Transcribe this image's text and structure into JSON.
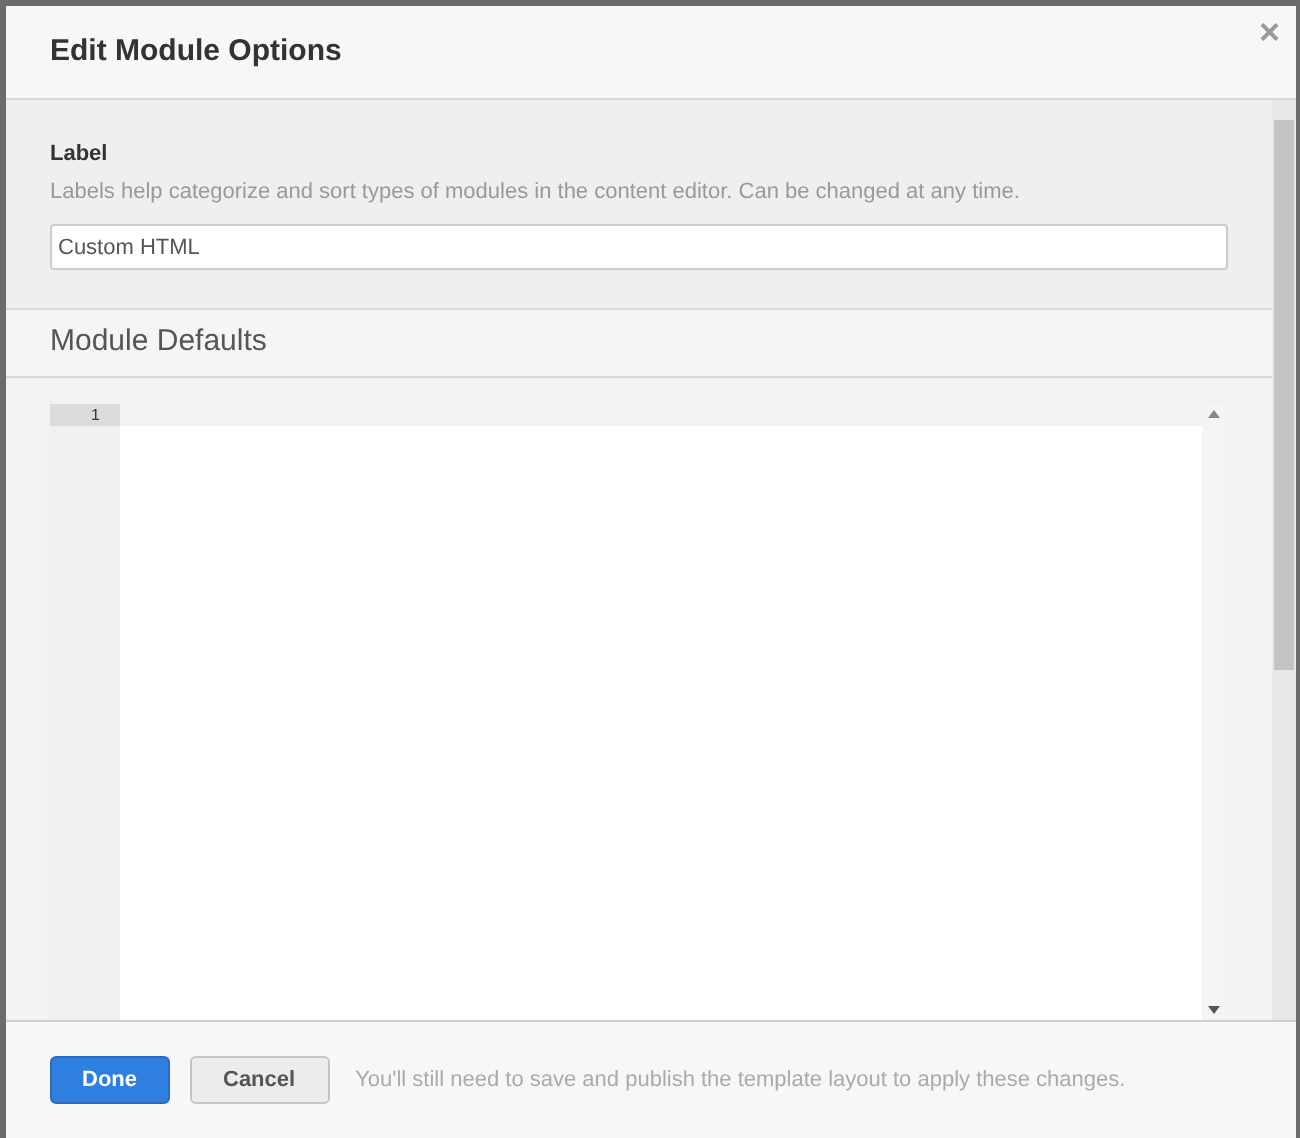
{
  "dialog": {
    "title": "Edit Module Options",
    "close": "×"
  },
  "label_section": {
    "heading": "Label",
    "help": "Labels help categorize and sort types of modules in the content editor. Can be changed at any time.",
    "value": "Custom HTML"
  },
  "defaults_section": {
    "heading": "Module Defaults",
    "editor": {
      "line_numbers": [
        "1"
      ]
    }
  },
  "footer": {
    "buttons": [
      {
        "label": "Done",
        "kind": "primary"
      },
      {
        "label": "Cancel",
        "kind": "secondary"
      }
    ],
    "note": "You'll still need to save and publish the template layout to apply these changes."
  }
}
